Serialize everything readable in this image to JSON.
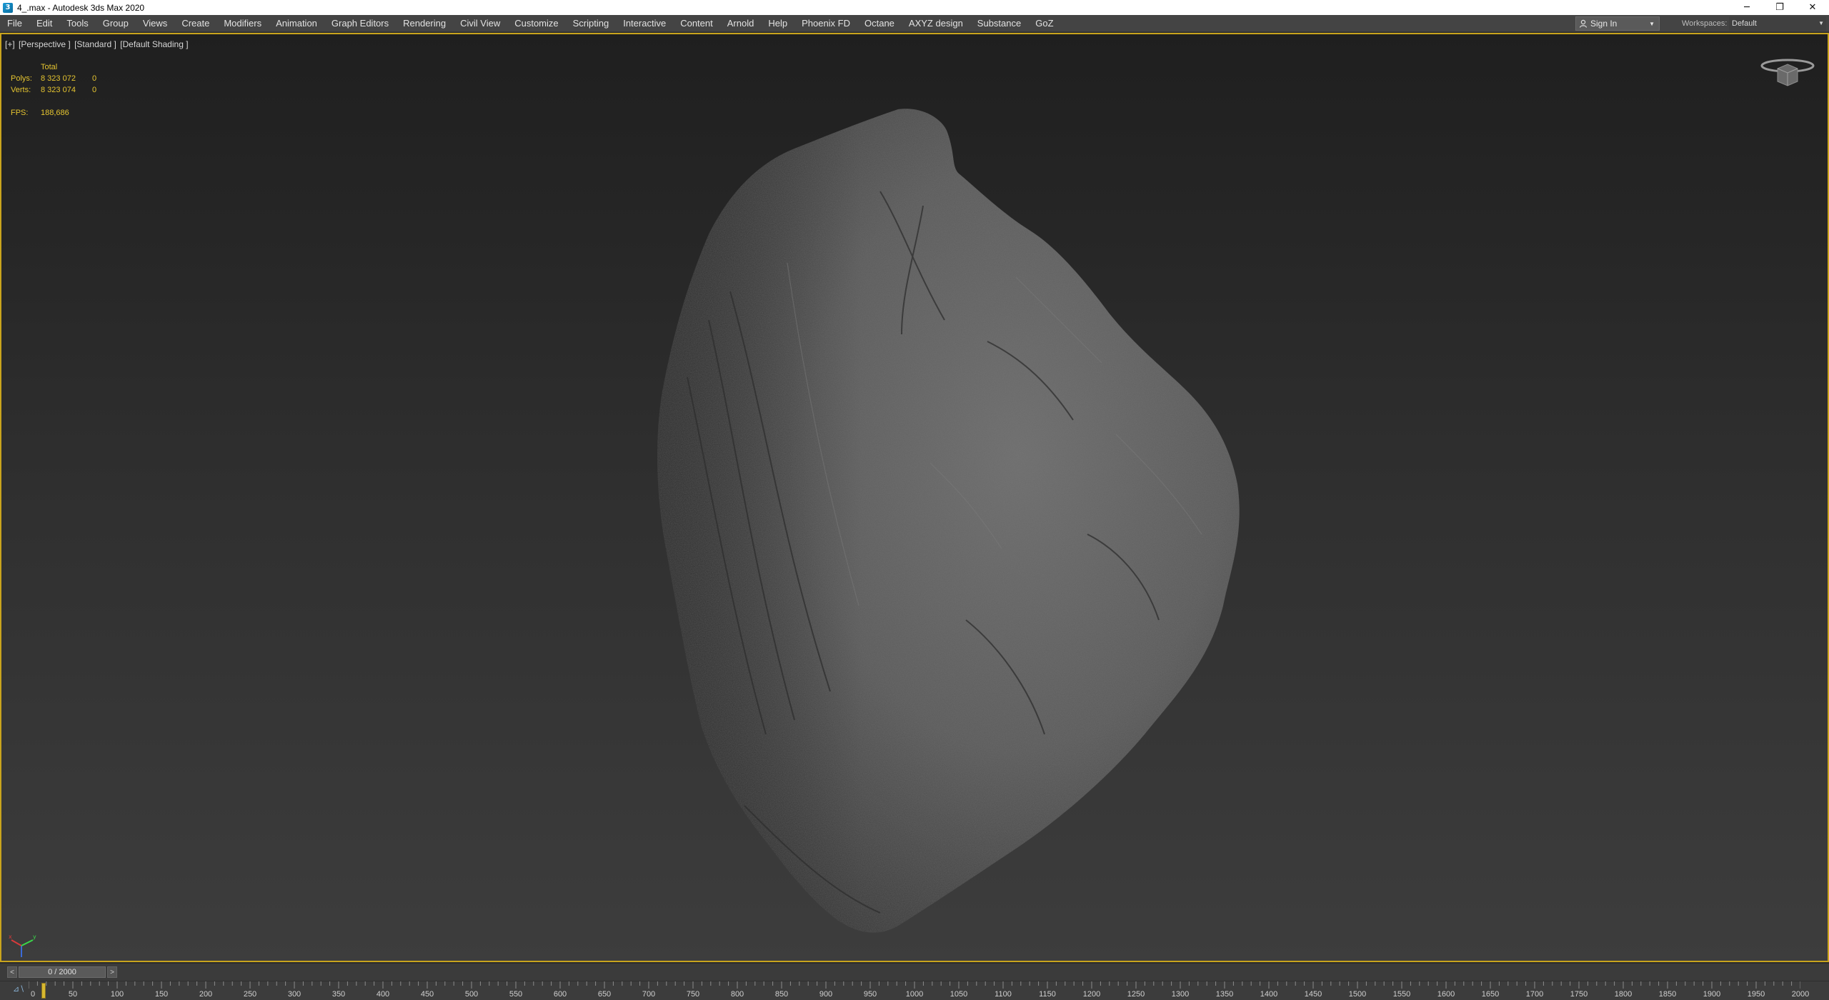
{
  "window": {
    "title": "4_.max - Autodesk 3ds Max 2020",
    "icon": "3ds-max-app-icon",
    "controls": {
      "minimize": "─",
      "restore": "❐",
      "close": "✕"
    }
  },
  "menubar": {
    "items": [
      "File",
      "Edit",
      "Tools",
      "Group",
      "Views",
      "Create",
      "Modifiers",
      "Animation",
      "Graph Editors",
      "Rendering",
      "Civil View",
      "Customize",
      "Scripting",
      "Interactive",
      "Content",
      "Arnold",
      "Help",
      "Phoenix FD",
      "Octane",
      "AXYZ design",
      "Substance",
      "GoZ"
    ],
    "signin_label": "Sign In",
    "workspaces_label": "Workspaces:",
    "workspace_value": "Default"
  },
  "viewport": {
    "label_parts": [
      "[+]",
      "[Perspective ]",
      "[Standard ]",
      "[Default Shading ]"
    ],
    "stats": {
      "total_label": "Total",
      "polys_label": "Polys:",
      "polys_value": "8 323 072",
      "polys_selected": "0",
      "verts_label": "Verts:",
      "verts_value": "8 323 074",
      "verts_selected": "0",
      "fps_label": "FPS:",
      "fps_value": "188,686"
    },
    "colors": {
      "frame": "#c9a41d",
      "stats": "#e5c430"
    }
  },
  "timeslider": {
    "prev": "<",
    "next": ">",
    "frame_display": "0 / 2000"
  },
  "trackbar": {
    "key_icon": "key-filter-icon",
    "tick_labels": [
      "0",
      "50",
      "100",
      "150",
      "200",
      "250",
      "300",
      "350",
      "400",
      "450",
      "500",
      "550",
      "600",
      "650",
      "700",
      "750",
      "800",
      "850",
      "900",
      "950",
      "1000",
      "1050",
      "1100",
      "1150",
      "1200",
      "1250",
      "1300",
      "1350",
      "1400",
      "1450",
      "1500",
      "1550",
      "1600",
      "1650",
      "1700",
      "1750",
      "1800",
      "1850",
      "1900",
      "1950",
      "2000"
    ],
    "range": [
      0,
      2000
    ],
    "current_frame": 0
  }
}
